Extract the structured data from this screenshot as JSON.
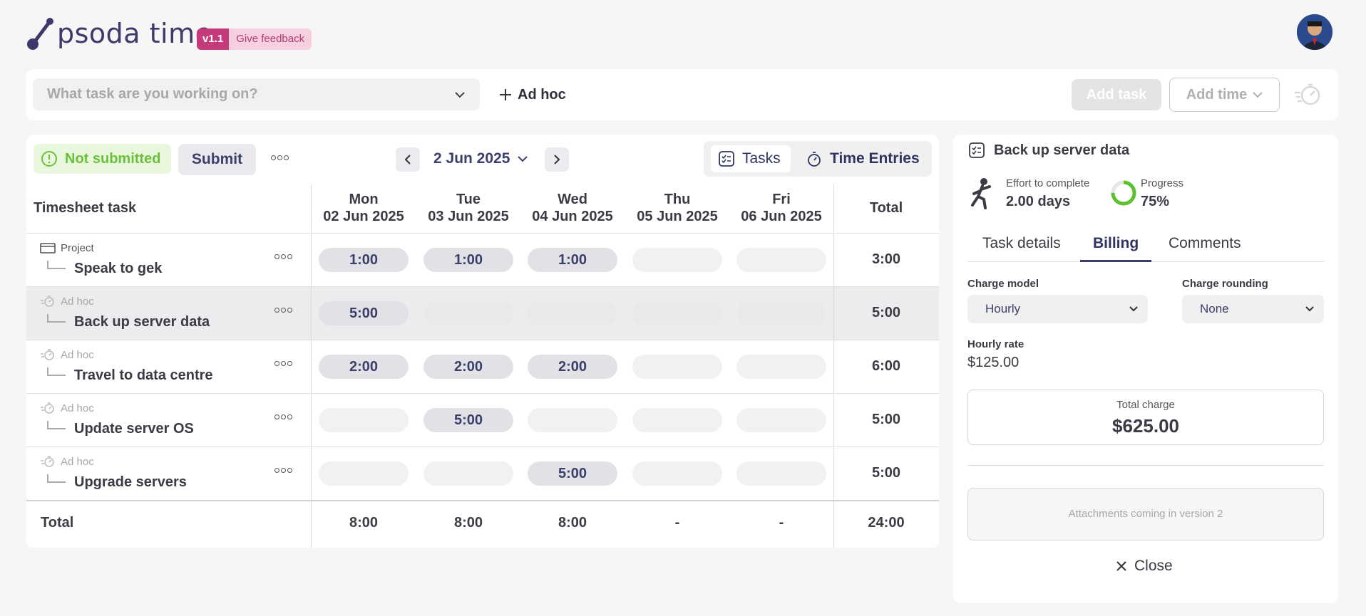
{
  "header": {
    "logo_text": "psoda time",
    "version_badge": "v1.1",
    "feedback_label": "Give feedback"
  },
  "taskbar": {
    "task_placeholder": "What task are you working on?",
    "adhoc_label": "Ad hoc",
    "add_task_label": "Add task",
    "add_time_label": "Add time"
  },
  "toolbar": {
    "status": "Not submitted",
    "submit_label": "Submit",
    "week_label": "2 Jun 2025",
    "view_tasks": "Tasks",
    "view_time_entries": "Time Entries"
  },
  "grid": {
    "task_header": "Timesheet task",
    "total_header": "Total",
    "days": [
      {
        "dow": "Mon",
        "date": "02 Jun 2025"
      },
      {
        "dow": "Tue",
        "date": "03 Jun 2025"
      },
      {
        "dow": "Wed",
        "date": "04 Jun 2025"
      },
      {
        "dow": "Thu",
        "date": "05 Jun 2025"
      },
      {
        "dow": "Fri",
        "date": "06 Jun 2025"
      }
    ],
    "rows": [
      {
        "type": "Project",
        "name": "Speak to gek",
        "cells": [
          "1:00",
          "1:00",
          "1:00",
          "",
          ""
        ],
        "total": "3:00"
      },
      {
        "type": "Ad hoc",
        "name": "Back up server data",
        "cells": [
          "5:00",
          "",
          "",
          "",
          ""
        ],
        "total": "5:00"
      },
      {
        "type": "Ad hoc",
        "name": "Travel to data centre",
        "cells": [
          "2:00",
          "2:00",
          "2:00",
          "",
          ""
        ],
        "total": "6:00"
      },
      {
        "type": "Ad hoc",
        "name": "Update server OS",
        "cells": [
          "",
          "5:00",
          "",
          "",
          ""
        ],
        "total": "5:00"
      },
      {
        "type": "Ad hoc",
        "name": "Upgrade servers",
        "cells": [
          "",
          "",
          "5:00",
          "",
          ""
        ],
        "total": "5:00"
      }
    ],
    "totals_label": "Total",
    "day_totals": [
      "8:00",
      "8:00",
      "8:00",
      "-",
      "-"
    ],
    "grand_total": "24:00"
  },
  "detail": {
    "title": "Back up server data",
    "effort_label": "Effort to complete",
    "effort_value": "2.00 days",
    "progress_label": "Progress",
    "progress_value": "75%",
    "progress_fraction": 0.75,
    "tabs": [
      "Task details",
      "Billing",
      "Comments"
    ],
    "charge_model_label": "Charge model",
    "charge_model_value": "Hourly",
    "charge_rounding_label": "Charge rounding",
    "charge_rounding_value": "None",
    "hourly_rate_label": "Hourly rate",
    "hourly_rate_value": "$125.00",
    "total_charge_label": "Total charge",
    "total_charge_value": "$625.00",
    "attachments_note": "Attachments coming in version 2",
    "close_label": "Close"
  },
  "colors": {
    "brand": "#3d3a6b",
    "badge": "#c43a7b",
    "status_green": "#6cc13a",
    "progress_ring": "#5cc12e"
  }
}
